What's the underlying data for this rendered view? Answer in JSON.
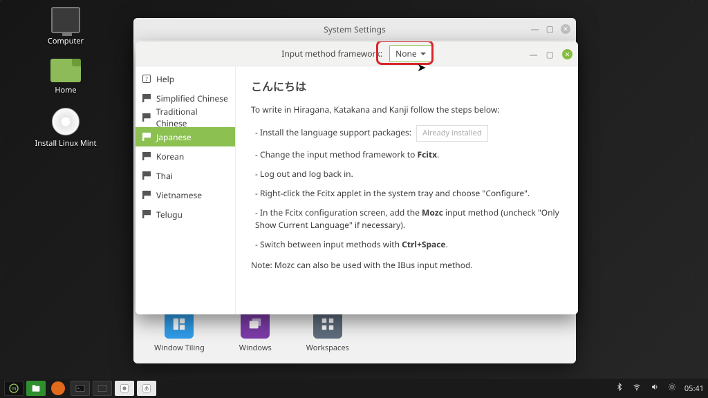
{
  "desktop": {
    "icons": [
      {
        "label": "Computer",
        "name": "desktop-icon-computer"
      },
      {
        "label": "Home",
        "name": "desktop-icon-home"
      },
      {
        "label": "Install Linux Mint",
        "name": "desktop-icon-install"
      }
    ]
  },
  "parent_window": {
    "title": "System Settings",
    "tiles": [
      {
        "label": "Window Tiling",
        "name": "tile-window-tiling"
      },
      {
        "label": "Windows",
        "name": "tile-windows"
      },
      {
        "label": "Workspaces",
        "name": "tile-workspaces"
      }
    ]
  },
  "im_window": {
    "framework_label": "Input method framework:",
    "framework_value": "None",
    "sidebar": [
      {
        "label": "Help",
        "icon": "help"
      },
      {
        "label": "Simplified Chinese",
        "icon": "flag"
      },
      {
        "label": "Traditional Chinese",
        "icon": "flag"
      },
      {
        "label": "Japanese",
        "icon": "flag",
        "active": true
      },
      {
        "label": "Korean",
        "icon": "flag"
      },
      {
        "label": "Thai",
        "icon": "flag"
      },
      {
        "label": "Vietnamese",
        "icon": "flag"
      },
      {
        "label": "Telugu",
        "icon": "flag"
      }
    ],
    "content": {
      "heading": "こんにちは",
      "intro": "To write in Hiragana, Katakana and Kanji follow the steps below:",
      "already_installed": "Already installed",
      "step1_pre": "Install the language support packages:",
      "step2_pre": "Change the input method framework to ",
      "step2_bold": "Fcitx",
      "step2_post": ".",
      "step3": "Log out and log back in.",
      "step4": "Right-click the Fcitx applet in the system tray and choose \"Configure\".",
      "step5_pre": "In the Fcitx configuration screen, add the ",
      "step5_bold": "Mozc",
      "step5_post": " input method (uncheck \"Only Show Current Language\" if necessary).",
      "step6_pre": "Switch between input methods with ",
      "step6_bold": "Ctrl+Space",
      "step6_post": ".",
      "note": "Note: Mozc can also be used with the IBus input method."
    }
  },
  "panel": {
    "clock": "05:41"
  }
}
